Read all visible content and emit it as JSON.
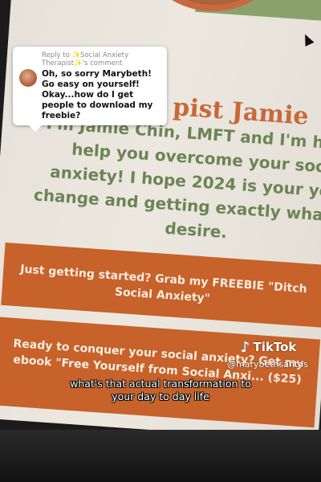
{
  "page": {
    "heading": "pist Jamie",
    "intro": "I'm Jamie Chin, LMFT and I'm he to help you overcome your soci anxiety! I hope 2024 is your year change and getting exactly wha you desire.",
    "cta_primary": "Just getting started? Grab my FREEBIE \"Ditch Social Anxiety\"",
    "cta_secondary": "Ready to conquer your social anxiety? Get my ebook \"Free Yourself from Social Anxi... ($25)",
    "colors": {
      "heading": "#c8683a",
      "intro": "#6b8554",
      "cta_bg": "#c6622a"
    }
  },
  "reply": {
    "header": "Reply to ✨Social Anxiety Therapist✨'s comment",
    "text": "Oh, so sorry Marybeth! Go easy on yourself! Okay...how do I get people to download my freebie?"
  },
  "watermark": {
    "logo": "TikTok",
    "handle": "@marybethsantos",
    "icon": "tiktok-note-icon"
  },
  "caption": "what's that actual transformation to your day to day life"
}
